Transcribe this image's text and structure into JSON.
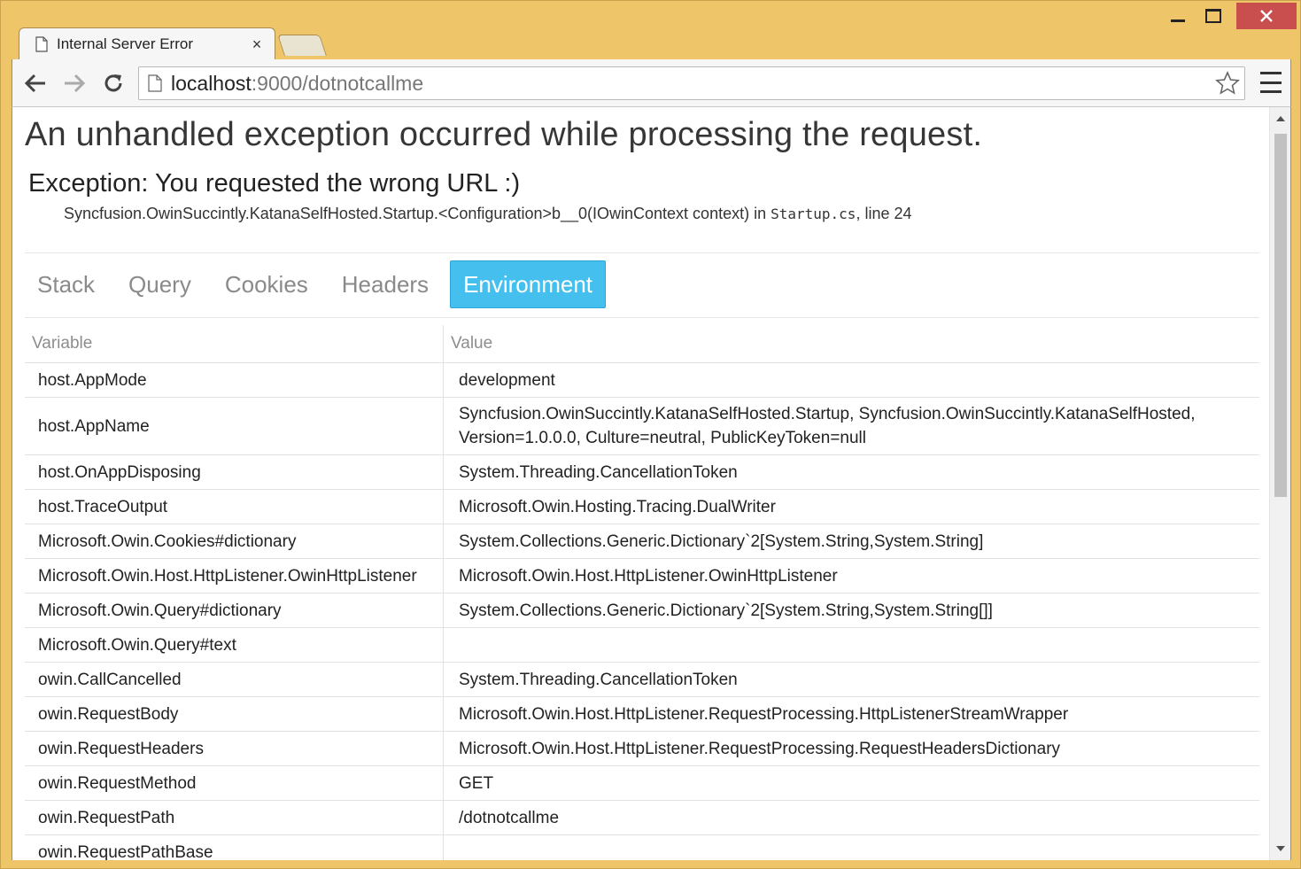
{
  "window": {
    "controls": [
      "minimize",
      "maximize",
      "close"
    ]
  },
  "browser": {
    "tab_title": "Internal Server Error",
    "tab_close": "×",
    "url_host": "localhost",
    "url_rest": ":9000/dotnotcallme"
  },
  "page": {
    "headline": "An unhandled exception occurred while processing the request.",
    "exception": "Exception: You requested the wrong URL :)",
    "location_prefix": "Syncfusion.OwinSuccintly.KatanaSelfHosted.Startup.<Configuration>b__0(IOwinContext context) in ",
    "location_file": "Startup.cs",
    "location_suffix": ", line 24",
    "tabs": [
      {
        "label": "Stack",
        "active": false
      },
      {
        "label": "Query",
        "active": false
      },
      {
        "label": "Cookies",
        "active": false
      },
      {
        "label": "Headers",
        "active": false
      },
      {
        "label": "Environment",
        "active": true
      }
    ],
    "table": {
      "headers": [
        "Variable",
        "Value"
      ],
      "rows": [
        [
          "host.AppMode",
          "development"
        ],
        [
          "host.AppName",
          "Syncfusion.OwinSuccintly.KatanaSelfHosted.Startup, Syncfusion.OwinSuccintly.KatanaSelfHosted, Version=1.0.0.0, Culture=neutral, PublicKeyToken=null"
        ],
        [
          "host.OnAppDisposing",
          "System.Threading.CancellationToken"
        ],
        [
          "host.TraceOutput",
          "Microsoft.Owin.Hosting.Tracing.DualWriter"
        ],
        [
          "Microsoft.Owin.Cookies#dictionary",
          "System.Collections.Generic.Dictionary`2[System.String,System.String]"
        ],
        [
          "Microsoft.Owin.Host.HttpListener.OwinHttpListener",
          "Microsoft.Owin.Host.HttpListener.OwinHttpListener"
        ],
        [
          "Microsoft.Owin.Query#dictionary",
          "System.Collections.Generic.Dictionary`2[System.String,System.String[]]"
        ],
        [
          "Microsoft.Owin.Query#text",
          ""
        ],
        [
          "owin.CallCancelled",
          "System.Threading.CancellationToken"
        ],
        [
          "owin.RequestBody",
          "Microsoft.Owin.Host.HttpListener.RequestProcessing.HttpListenerStreamWrapper"
        ],
        [
          "owin.RequestHeaders",
          "Microsoft.Owin.Host.HttpListener.RequestProcessing.RequestHeadersDictionary"
        ],
        [
          "owin.RequestMethod",
          "GET"
        ],
        [
          "owin.RequestPath",
          "/dotnotcallme"
        ],
        [
          "owin.RequestPathBase",
          ""
        ]
      ]
    }
  },
  "colors": {
    "window_frame": "#efc56a",
    "close_button": "#c94f4f",
    "active_tab": "#45c0ee"
  }
}
